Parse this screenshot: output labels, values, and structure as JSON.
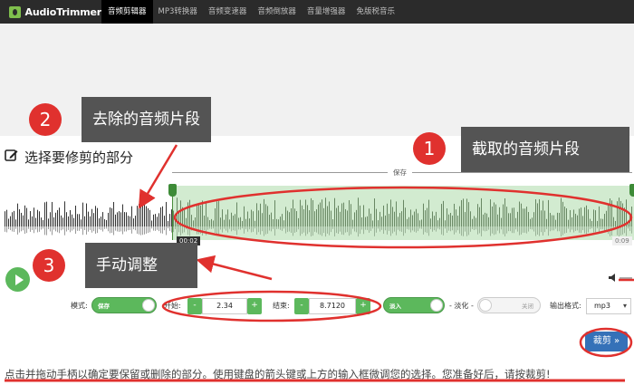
{
  "brand": {
    "name": "AudioTrimmer"
  },
  "nav": {
    "items": [
      {
        "label": "音频剪辑器",
        "active": true
      },
      {
        "label": "MP3转换器",
        "active": false
      },
      {
        "label": "音频变速器",
        "active": false
      },
      {
        "label": "音频倒放器",
        "active": false
      },
      {
        "label": "音量增强器",
        "active": false
      },
      {
        "label": "免版税音乐",
        "active": false
      }
    ]
  },
  "editor": {
    "section_title": "选择要修剪的部分",
    "save_label": "保存",
    "time_start": "00:02",
    "time_end": "0:09"
  },
  "controls": {
    "mode_label": "模式:",
    "mode_value": "保存",
    "start_label": "开始:",
    "start_value": "2.34",
    "end_label": "结束:",
    "end_value": "8.7120",
    "minus": "-",
    "plus": "+",
    "fade_in_value": "淡入",
    "fade_out_label": "- 淡化 -",
    "fade_out_value": "关闭",
    "format_label": "输出格式:",
    "format_value": "mp3",
    "cut_label": "裁剪 »"
  },
  "instructions": "点击并拖动手柄以确定要保留或删除的部分。使用键盘的箭头键或上方的输入框微调您的选择。您准备好后，请按裁剪!",
  "annotations": {
    "badge1": "1",
    "badge2": "2",
    "badge3": "3",
    "callout1": "截取的音频片段",
    "callout2": "去除的音频片段",
    "callout3": "手动调整"
  },
  "colors": {
    "accent_green": "#5cb85c",
    "cut_blue": "#3571b8",
    "annotation_red": "#e0312e",
    "callout_gray": "#545454"
  },
  "icons": {
    "edit": "edit-icon",
    "play": "play-icon",
    "volume": "volume-icon"
  }
}
